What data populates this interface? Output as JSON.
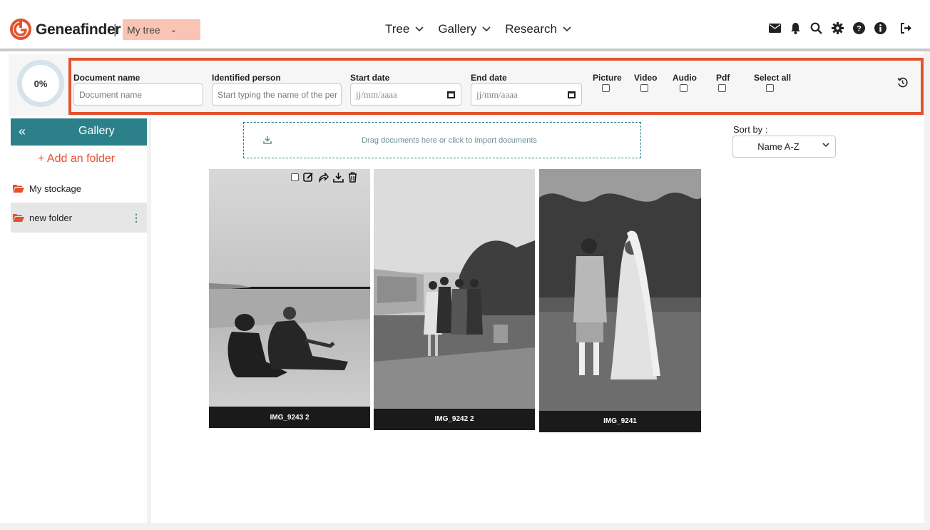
{
  "header": {
    "brand": "Geneafinder",
    "separator": "|",
    "tree_select": "My tree",
    "nav": [
      {
        "label": "Tree"
      },
      {
        "label": "Gallery"
      },
      {
        "label": "Research"
      }
    ],
    "icons": [
      "mail-icon",
      "bell-icon",
      "search-icon",
      "gear-icon",
      "help-icon",
      "info-icon",
      "logout-icon"
    ]
  },
  "filters": {
    "progress": "0%",
    "document_name": {
      "label": "Document name",
      "placeholder": "Document name"
    },
    "identified_person": {
      "label": "Identified person",
      "placeholder": "Start typing the name of the per"
    },
    "start_date": {
      "label": "Start date",
      "placeholder": "jj/mm/aaaa"
    },
    "end_date": {
      "label": "End date",
      "placeholder": "jj/mm/aaaa"
    },
    "types": [
      {
        "label": "Picture"
      },
      {
        "label": "Video"
      },
      {
        "label": "Audio"
      },
      {
        "label": "Pdf"
      },
      {
        "label": "Select all"
      }
    ],
    "accent": "#e2522e"
  },
  "sidebar": {
    "collapse": "«",
    "title": "Gallery",
    "add_folder": "+ Add an folder",
    "folders": [
      {
        "label": "My stockage"
      },
      {
        "label": "new folder"
      }
    ],
    "kebab": "⋮",
    "accent": "#2c8089"
  },
  "gallery": {
    "dropzone_text": "Drag documents here or click to import documents",
    "sort_label": "Sort by :",
    "sort_value": "Name A-Z",
    "documents": [
      {
        "name": "IMG_9243 2"
      },
      {
        "name": "IMG_9242 2"
      },
      {
        "name": "IMG_9241"
      }
    ]
  }
}
